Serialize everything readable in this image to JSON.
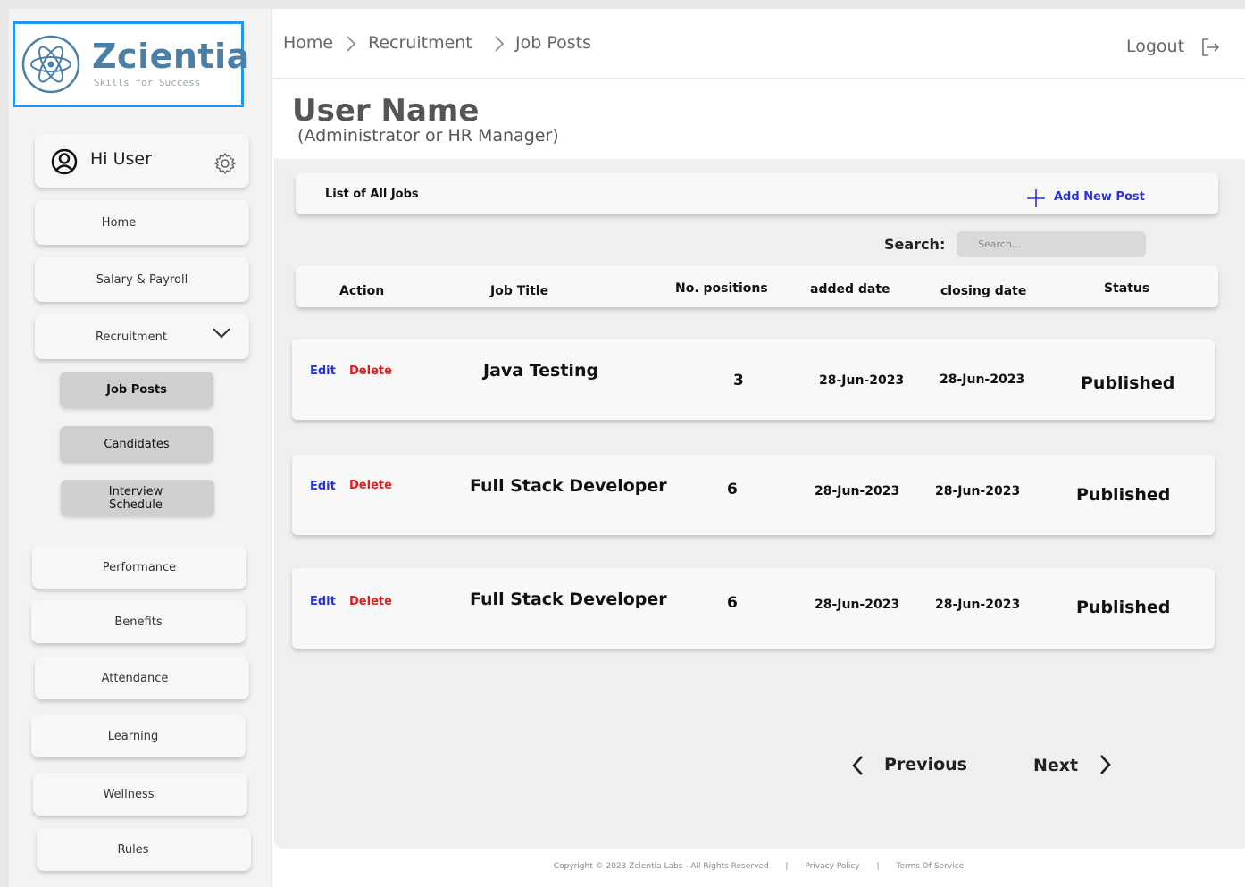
{
  "brand": {
    "name": "Zcientia",
    "tagline": "Skills for Success",
    "accent": "#2196f3"
  },
  "user": {
    "greeting": "Hi User",
    "name": "User Name",
    "role": "(Administrator or HR Manager)"
  },
  "sidebar": {
    "items": [
      {
        "label": "Home"
      },
      {
        "label": "Salary &  Payroll"
      },
      {
        "label": "Recruitment"
      },
      {
        "label": "Performance"
      },
      {
        "label": "Benefits"
      },
      {
        "label": "Attendance"
      },
      {
        "label": "Learning"
      },
      {
        "label": "Wellness"
      },
      {
        "label": "Rules"
      }
    ],
    "recruitment_sub": [
      {
        "label": "Job Posts"
      },
      {
        "label": "Candidates"
      },
      {
        "label": "Interview Schedule"
      }
    ]
  },
  "breadcrumb": [
    "Home",
    "Recruitment",
    "Job Posts"
  ],
  "header": {
    "logout_label": "Logout"
  },
  "list": {
    "title": "List of  All Jobs",
    "add_label": "Add New Post",
    "search_label": "Search:",
    "search_placeholder": "Search..."
  },
  "table": {
    "columns": [
      "Action",
      "Job Title",
      "No. positions",
      "added date",
      "closing date",
      "Status"
    ],
    "edit_label": "Edit",
    "delete_label": "Delete",
    "rows": [
      {
        "title": "Java Testing",
        "positions": "3",
        "added": "28-Jun-2023",
        "closing": "28-Jun-2023",
        "status": "Published"
      },
      {
        "title": "Full Stack  Developer",
        "positions": "6",
        "added": "28-Jun-2023",
        "closing": "28-Jun-2023",
        "status": "Published"
      },
      {
        "title": "Full Stack  Developer",
        "positions": "6",
        "added": "28-Jun-2023",
        "closing": "28-Jun-2023",
        "status": "Published"
      }
    ]
  },
  "pagination": {
    "previous_label": "Previous",
    "next_label": "Next"
  },
  "footer": {
    "copyright": "Copyright © 2023 Zcientia Labs - All Rights Reserved",
    "separator": "|",
    "privacy": "Privacy Policy",
    "terms": "Terms Of Service"
  }
}
